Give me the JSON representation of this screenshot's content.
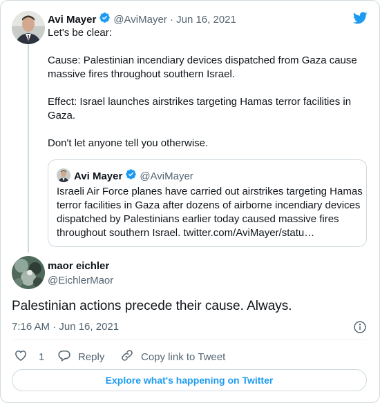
{
  "colors": {
    "brand": "#1d9bf0",
    "text": "#0f1419",
    "muted": "#536471",
    "border": "#cfd9de"
  },
  "original_tweet": {
    "author_name": "Avi Mayer",
    "handle_date": "@AviMayer · Jun 16, 2021",
    "lines": [
      "Let's be clear:",
      "Cause: Palestinian incendiary devices dispatched from Gaza cause massive fires throughout southern Israel.",
      "Effect: Israel launches airstrikes targeting Hamas terror facilities in Gaza.",
      "Don't let anyone tell you otherwise."
    ]
  },
  "quoted_tweet": {
    "author_name": "Avi Mayer",
    "handle": "@AviMayer",
    "text": "Israeli Air Force planes have carried out airstrikes targeting Hamas terror facilities in Gaza after dozens of airborne incendiary devices dispatched by Palestinians earlier today caused massive fires throughout southern Israel. twitter.com/AviMayer/statu…"
  },
  "reply_tweet": {
    "author_name": "maor eichler",
    "handle": "@EichlerMaor",
    "text": "Palestinian actions precede their cause. Always.",
    "timestamp": "7:16 AM · Jun 16, 2021"
  },
  "actions": {
    "like_count": "1",
    "reply_label": "Reply",
    "copy_link_label": "Copy link to Tweet"
  },
  "explore_label": "Explore what's happening on Twitter",
  "icons": [
    "twitter-bird-icon",
    "verified-badge-icon",
    "info-icon",
    "heart-icon",
    "reply-icon",
    "link-icon"
  ]
}
